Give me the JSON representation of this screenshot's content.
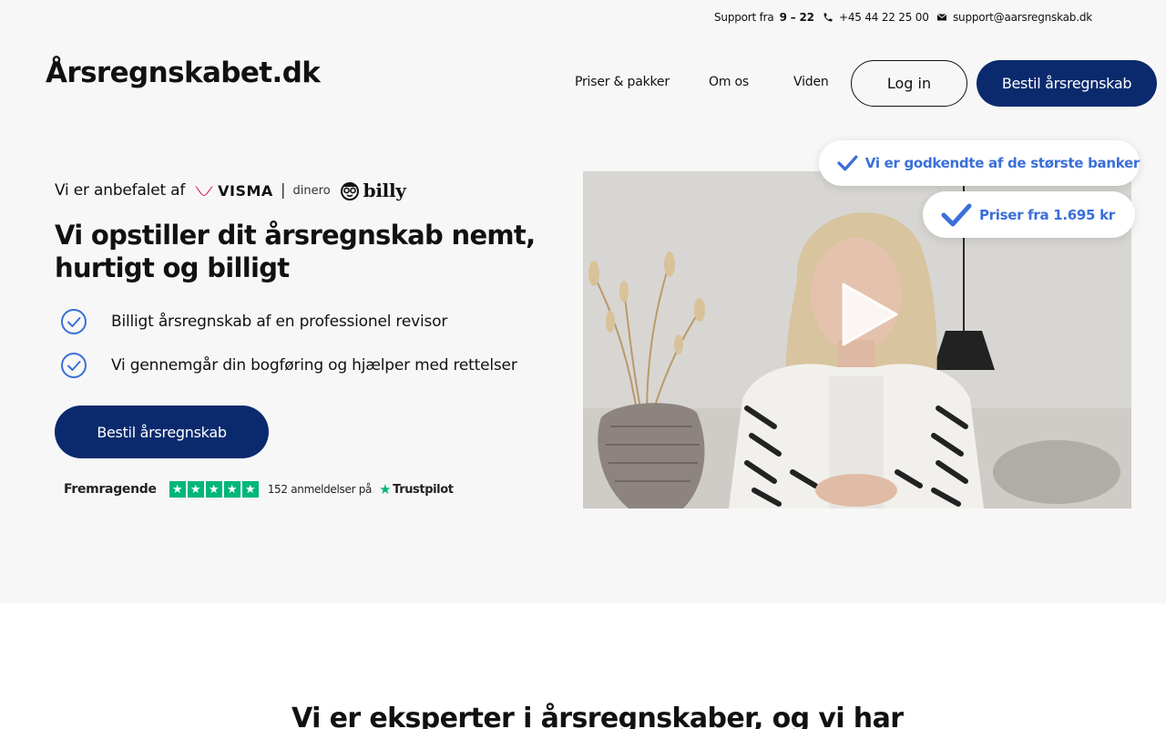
{
  "topbar": {
    "support_prefix": "Support fra ",
    "support_hours": "9 – 22",
    "phone": "+45 44 22 25 00",
    "email": "support@aarsregnskab.dk"
  },
  "header": {
    "logo": "Årsregnskabet.dk",
    "nav": [
      "Priser & pakker",
      "Om os",
      "Viden"
    ],
    "login_label": "Log in",
    "order_label": "Bestil årsregnskab"
  },
  "hero": {
    "recommended_by": "Vi er anbefalet af",
    "partners": {
      "visma": "VISMA",
      "separator": "|",
      "dinero": "dinero",
      "billy": "billy"
    },
    "title": "Vi opstiller dit årsregnskab nemt, hurtigt og billigt",
    "features": [
      "Billigt årsregnskab af en professionel revisor",
      "Vi gennemgår din bogføring og hjælper med rettelser"
    ],
    "cta_label": "Bestil årsregnskab",
    "trustpilot": {
      "rating_text": "Fremragende",
      "reviews_text": "152 anmeldelser på",
      "brand": "Trustpilot",
      "stars": 5
    }
  },
  "video": {
    "badges": [
      "Vi er godkendte af de største banker",
      "Priser fra 1.695 kr"
    ]
  },
  "section2": {
    "title": "Vi er eksperter i årsregnskaber, og vi har"
  },
  "colors": {
    "brand_navy": "#0b2a6e",
    "check_blue": "#3a6fd8",
    "trustpilot_green": "#00b67a",
    "visma_red": "#e0245e",
    "hero_bg": "#f7f7f7"
  },
  "icons": {
    "phone": "phone-icon",
    "mail": "envelope-icon",
    "check": "check-circle-icon",
    "play": "play-icon"
  }
}
